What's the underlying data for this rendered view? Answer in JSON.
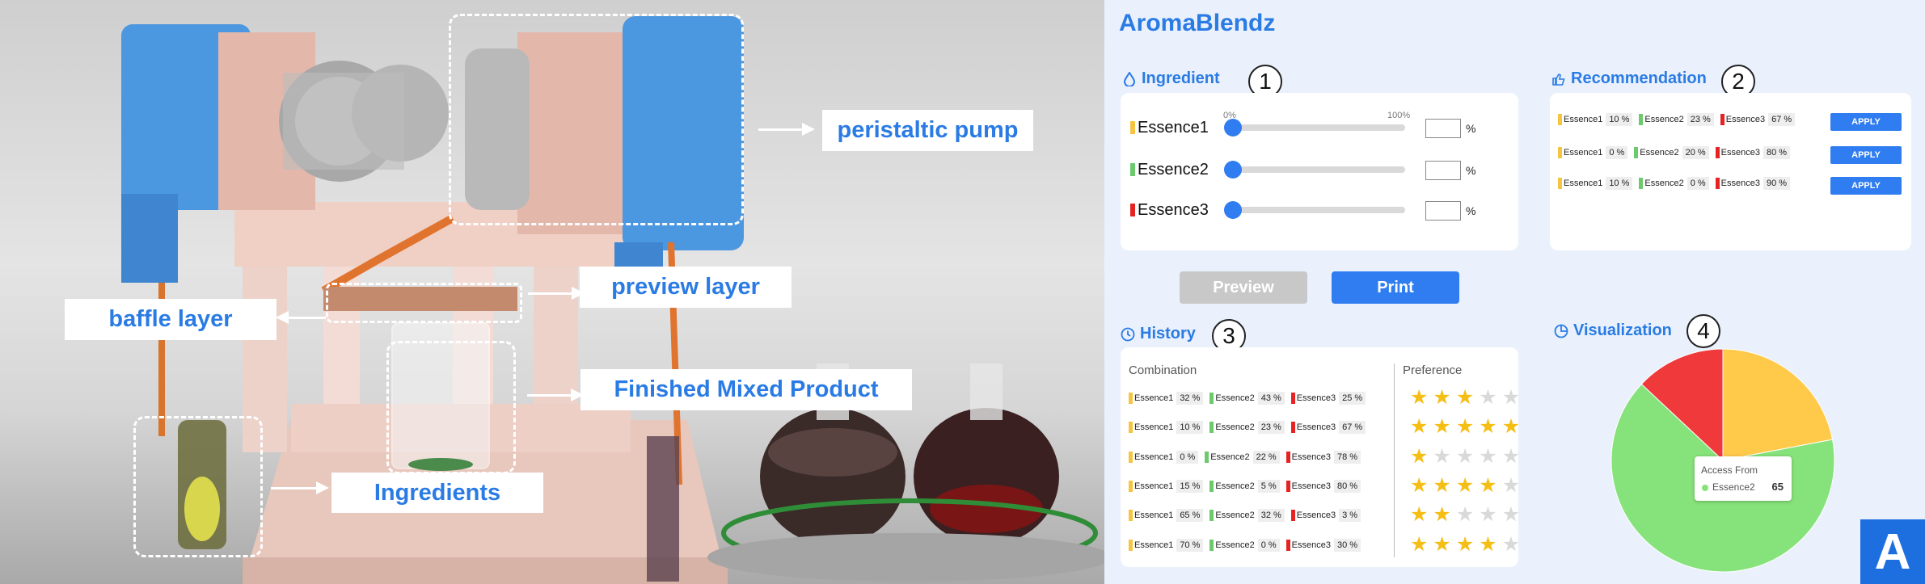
{
  "figure": {
    "callouts": {
      "peristaltic_pump": "peristaltic pump",
      "preview_layer": "preview layer",
      "baffle_layer": "baffle layer",
      "finished_mixed_product": "Finished Mixed Product",
      "ingredients": "Ingredients"
    },
    "corner_badge": "A"
  },
  "app": {
    "title": "AromaBlendz",
    "colors": {
      "accent": "#2a7be4",
      "essence1": "#f5c542",
      "essence2": "#6cc96c",
      "essence3": "#e62222",
      "button_blue": "#2f7df0",
      "button_gray": "#c8c8c8"
    },
    "ingredient": {
      "title": "Ingredient",
      "icon": "drop-icon",
      "number": "1",
      "scale_min": "0%",
      "scale_max": "100%",
      "unit": "%",
      "items": [
        {
          "name": "Essence1",
          "slider_value": 0,
          "input_value": ""
        },
        {
          "name": "Essence2",
          "slider_value": 0,
          "input_value": ""
        },
        {
          "name": "Essence3",
          "slider_value": 0,
          "input_value": ""
        }
      ]
    },
    "buttons": {
      "preview": "Preview",
      "print": "Print"
    },
    "recommendation": {
      "title": "Recommendation",
      "icon": "thumbs-up-icon",
      "number": "2",
      "apply_label": "APPLY",
      "rows": [
        {
          "e1": "Essence1",
          "v1": "10 %",
          "e2": "Essence2",
          "v2": "23 %",
          "e3": "Essence3",
          "v3": "67 %"
        },
        {
          "e1": "Essence1",
          "v1": "0 %",
          "e2": "Essence2",
          "v2": "20 %",
          "e3": "Essence3",
          "v3": "80 %"
        },
        {
          "e1": "Essence1",
          "v1": "10 %",
          "e2": "Essence2",
          "v2": "0 %",
          "e3": "Essence3",
          "v3": "90 %"
        }
      ]
    },
    "history": {
      "title": "History",
      "icon": "clock-icon",
      "number": "3",
      "col_combination": "Combination",
      "col_preference": "Preference",
      "rows": [
        {
          "e1": "Essence1",
          "v1": "32 %",
          "e2": "Essence2",
          "v2": "43 %",
          "e3": "Essence3",
          "v3": "25 %",
          "stars": 3
        },
        {
          "e1": "Essence1",
          "v1": "10 %",
          "e2": "Essence2",
          "v2": "23 %",
          "e3": "Essence3",
          "v3": "67 %",
          "stars": 5
        },
        {
          "e1": "Essence1",
          "v1": "0 %",
          "e2": "Essence2",
          "v2": "22 %",
          "e3": "Essence3",
          "v3": "78 %",
          "stars": 1
        },
        {
          "e1": "Essence1",
          "v1": "15 %",
          "e2": "Essence2",
          "v2": "5 %",
          "e3": "Essence3",
          "v3": "80 %",
          "stars": 4
        },
        {
          "e1": "Essence1",
          "v1": "65 %",
          "e2": "Essence2",
          "v2": "32 %",
          "e3": "Essence3",
          "v3": "3 %",
          "stars": 2
        },
        {
          "e1": "Essence1",
          "v1": "70 %",
          "e2": "Essence2",
          "v2": "0 %",
          "e3": "Essence3",
          "v3": "30 %",
          "stars": 4
        }
      ]
    },
    "visualization": {
      "title": "Visualization",
      "icon": "pie-chart-icon",
      "number": "4",
      "tooltip_title": "Access From",
      "tooltip_series": "Essence2",
      "tooltip_value": "65"
    }
  },
  "chart_data": {
    "type": "pie",
    "slices": [
      {
        "name": "Essence1",
        "value": 22,
        "color": "#ffc94a"
      },
      {
        "name": "Essence2",
        "value": 65,
        "color": "#86e27a"
      },
      {
        "name": "Essence3",
        "value": 13,
        "color": "#f0393b"
      }
    ]
  }
}
